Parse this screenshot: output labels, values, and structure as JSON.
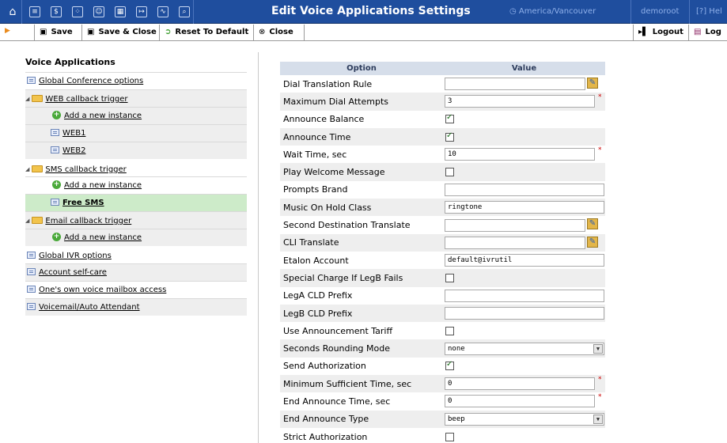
{
  "header": {
    "title": "Edit Voice Applications Settings",
    "timezone": "America/Vancouver",
    "user": "demoroot",
    "help": "Hel"
  },
  "toolbar": {
    "save": "Save",
    "save_close": "Save & Close",
    "reset": "Reset To Default",
    "close": "Close",
    "logout": "Logout",
    "log": "Log"
  },
  "left": {
    "heading": "Voice Applications",
    "items": [
      {
        "label": "Global Conference options"
      },
      {
        "label": "WEB callback trigger"
      },
      {
        "label": "Add a new instance"
      },
      {
        "label": "WEB1"
      },
      {
        "label": "WEB2"
      },
      {
        "label": "SMS callback trigger"
      },
      {
        "label": "Add a new instance"
      },
      {
        "label": "Free SMS"
      },
      {
        "label": "Email callback trigger"
      },
      {
        "label": "Add a new instance"
      },
      {
        "label": "Global IVR options"
      },
      {
        "label": "Account self-care"
      },
      {
        "label": "One's own voice mailbox access"
      },
      {
        "label": "Voicemail/Auto Attendant"
      }
    ]
  },
  "table": {
    "col_option": "Option",
    "col_value": "Value",
    "rows": [
      {
        "label": "Dial Translation Rule",
        "value": ""
      },
      {
        "label": "Maximum Dial Attempts",
        "value": "3"
      },
      {
        "label": "Announce Balance",
        "checked": true
      },
      {
        "label": "Announce Time",
        "checked": true
      },
      {
        "label": "Wait Time, sec",
        "value": "10"
      },
      {
        "label": "Play Welcome Message",
        "checked": false
      },
      {
        "label": "Prompts Brand",
        "value": ""
      },
      {
        "label": "Music On Hold Class",
        "value": "ringtone"
      },
      {
        "label": "Second Destination Translate",
        "value": ""
      },
      {
        "label": "CLI Translate",
        "value": ""
      },
      {
        "label": "Etalon Account",
        "value": "default@ivrutil"
      },
      {
        "label": "Special Charge If LegB Fails",
        "checked": false
      },
      {
        "label": "LegA CLD Prefix",
        "value": ""
      },
      {
        "label": "LegB CLD Prefix",
        "value": ""
      },
      {
        "label": "Use Announcement Tariff",
        "checked": false
      },
      {
        "label": "Seconds Rounding Mode",
        "value": "none"
      },
      {
        "label": "Send Authorization",
        "checked": true
      },
      {
        "label": "Minimum Sufficient Time, sec",
        "value": "0"
      },
      {
        "label": "End Announce Time, sec",
        "value": "0"
      },
      {
        "label": "End Announce Type",
        "value": "beep"
      },
      {
        "label": "Strict Authorization",
        "checked": false
      }
    ]
  },
  "colors": {
    "topbar": "#1f4e9e",
    "table_header": "#d6deea",
    "selected_item": "#cdebc9"
  }
}
